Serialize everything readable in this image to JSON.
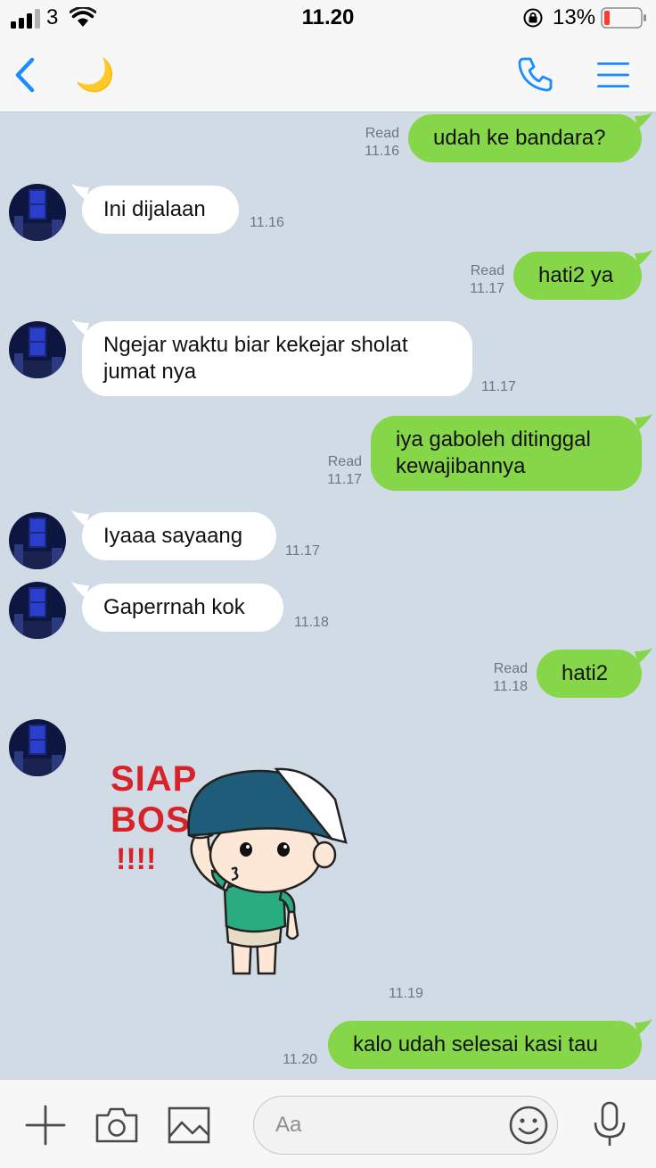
{
  "status_bar": {
    "carrier": "3",
    "time": "11.20",
    "battery": "13%"
  },
  "header": {
    "title_emoji": "🌙",
    "icons": [
      "back-chevron-icon",
      "phone-icon",
      "menu-icon"
    ]
  },
  "messages": [
    {
      "side": "out",
      "text": "udah ke bandara?",
      "read": "Read",
      "time": "11.16"
    },
    {
      "side": "in",
      "text": "Ini dijalaan",
      "time": "11.16"
    },
    {
      "side": "out",
      "text": "hati2 ya",
      "read": "Read",
      "time": "11.17"
    },
    {
      "side": "in",
      "text": "Ngejar waktu biar kekejar sholat jumat nya",
      "time": "11.17"
    },
    {
      "side": "out",
      "text": "iya gaboleh ditinggal kewajibannya",
      "read": "Read",
      "time": "11.17"
    },
    {
      "side": "in",
      "text": "Iyaaa sayaang",
      "time": "11.17"
    },
    {
      "side": "in",
      "text": "Gaperrnah kok",
      "time": "11.18"
    },
    {
      "side": "out",
      "text": "hati2",
      "read": "Read",
      "time": "11.18"
    },
    {
      "side": "in",
      "type": "sticker",
      "sticker_text": [
        "SIAP",
        "BOS",
        "!!!!"
      ],
      "time": "11.19"
    },
    {
      "side": "out",
      "text": "kalo udah selesai kasi tau",
      "time": "11.20"
    }
  ],
  "composer": {
    "placeholder": "Aa",
    "icons": [
      "plus-icon",
      "camera-icon",
      "image-icon",
      "emoji-icon",
      "microphone-icon"
    ]
  },
  "colors": {
    "outgoing_bubble": "#86d64a",
    "incoming_bubble": "#ffffff",
    "chat_background": "#d1dbe5",
    "accent": "#1a8cff"
  }
}
